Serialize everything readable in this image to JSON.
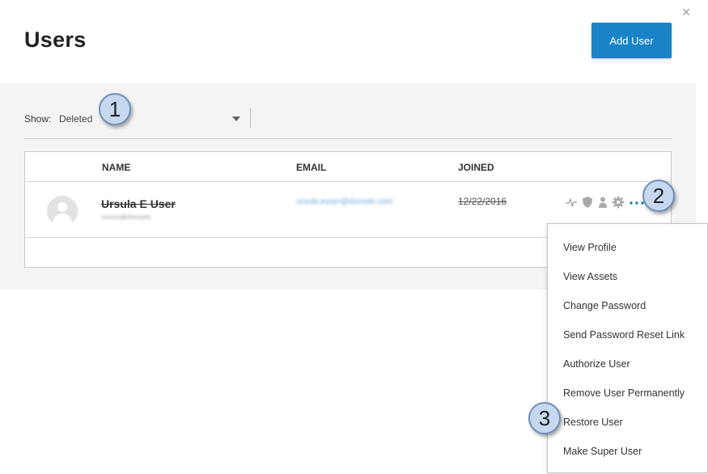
{
  "header": {
    "title": "Users",
    "add_user_label": "Add User",
    "close_glyph": "×"
  },
  "filter": {
    "label": "Show:",
    "value": "Deleted"
  },
  "table": {
    "columns": [
      "NAME",
      "EMAIL",
      "JOINED"
    ],
    "rows": [
      {
        "name": "Ursula E User",
        "subtext": "uuser@domain",
        "email": "ursula.euser@domain.com",
        "joined": "12/22/2016",
        "deleted": true
      }
    ]
  },
  "row_actions": [
    "activity-icon",
    "shield-icon",
    "person-icon",
    "gear-icon",
    "more-icon"
  ],
  "context_menu": {
    "items": [
      "View Profile",
      "View Assets",
      "Change Password",
      "Send Password Reset Link",
      "Authorize User",
      "Remove User Permanently",
      "Restore User",
      "Make Super User"
    ]
  },
  "callouts": [
    "1",
    "2",
    "3"
  ],
  "colors": {
    "accent": "#1a83c6",
    "panel_bg": "#f4f4f4",
    "callout_fill": "#c6d8ee",
    "callout_border": "#6d8fbf"
  }
}
